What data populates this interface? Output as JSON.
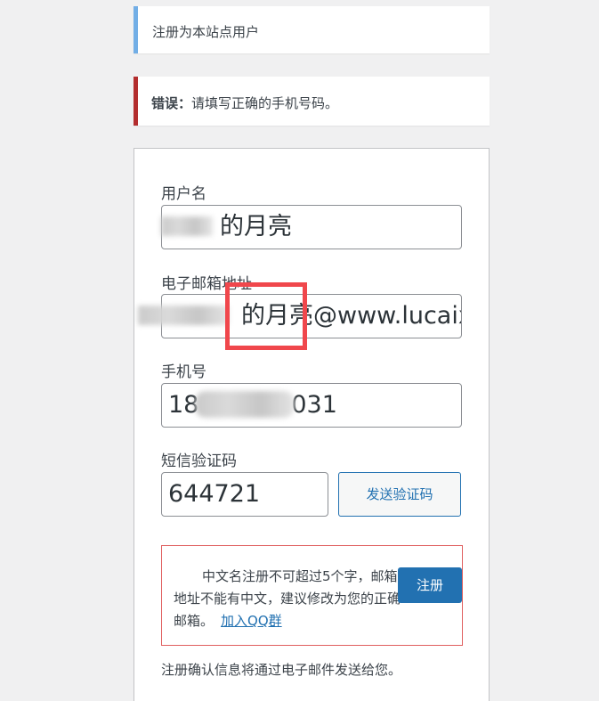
{
  "notice_info": {
    "text": "注册为本站点用户"
  },
  "notice_error": {
    "prefix": "错误：",
    "message": "请填写正确的手机号码。"
  },
  "form": {
    "username_label": "用户名",
    "username_value": "的月亮",
    "email_label": "电子邮箱地址",
    "email_value": "的月亮@www.lucaix",
    "phone_label": "手机号",
    "phone_prefix": "18",
    "phone_suffix": "031",
    "sms_label": "短信验证码",
    "sms_value": "644721",
    "send_code_button": "发送验证码",
    "tip_text": "中文名注册不可超过5个字，邮箱地址不能有中文，建议修改为您的正确邮箱。",
    "tip_link": "加入QQ群",
    "register_button": "注册",
    "confirm_text": "注册确认信息将通过电子邮件发送给您。"
  },
  "colors": {
    "info_border": "#72aee6",
    "error_border": "#b32d2e",
    "primary": "#2271b1",
    "highlight": "#f0474c"
  }
}
